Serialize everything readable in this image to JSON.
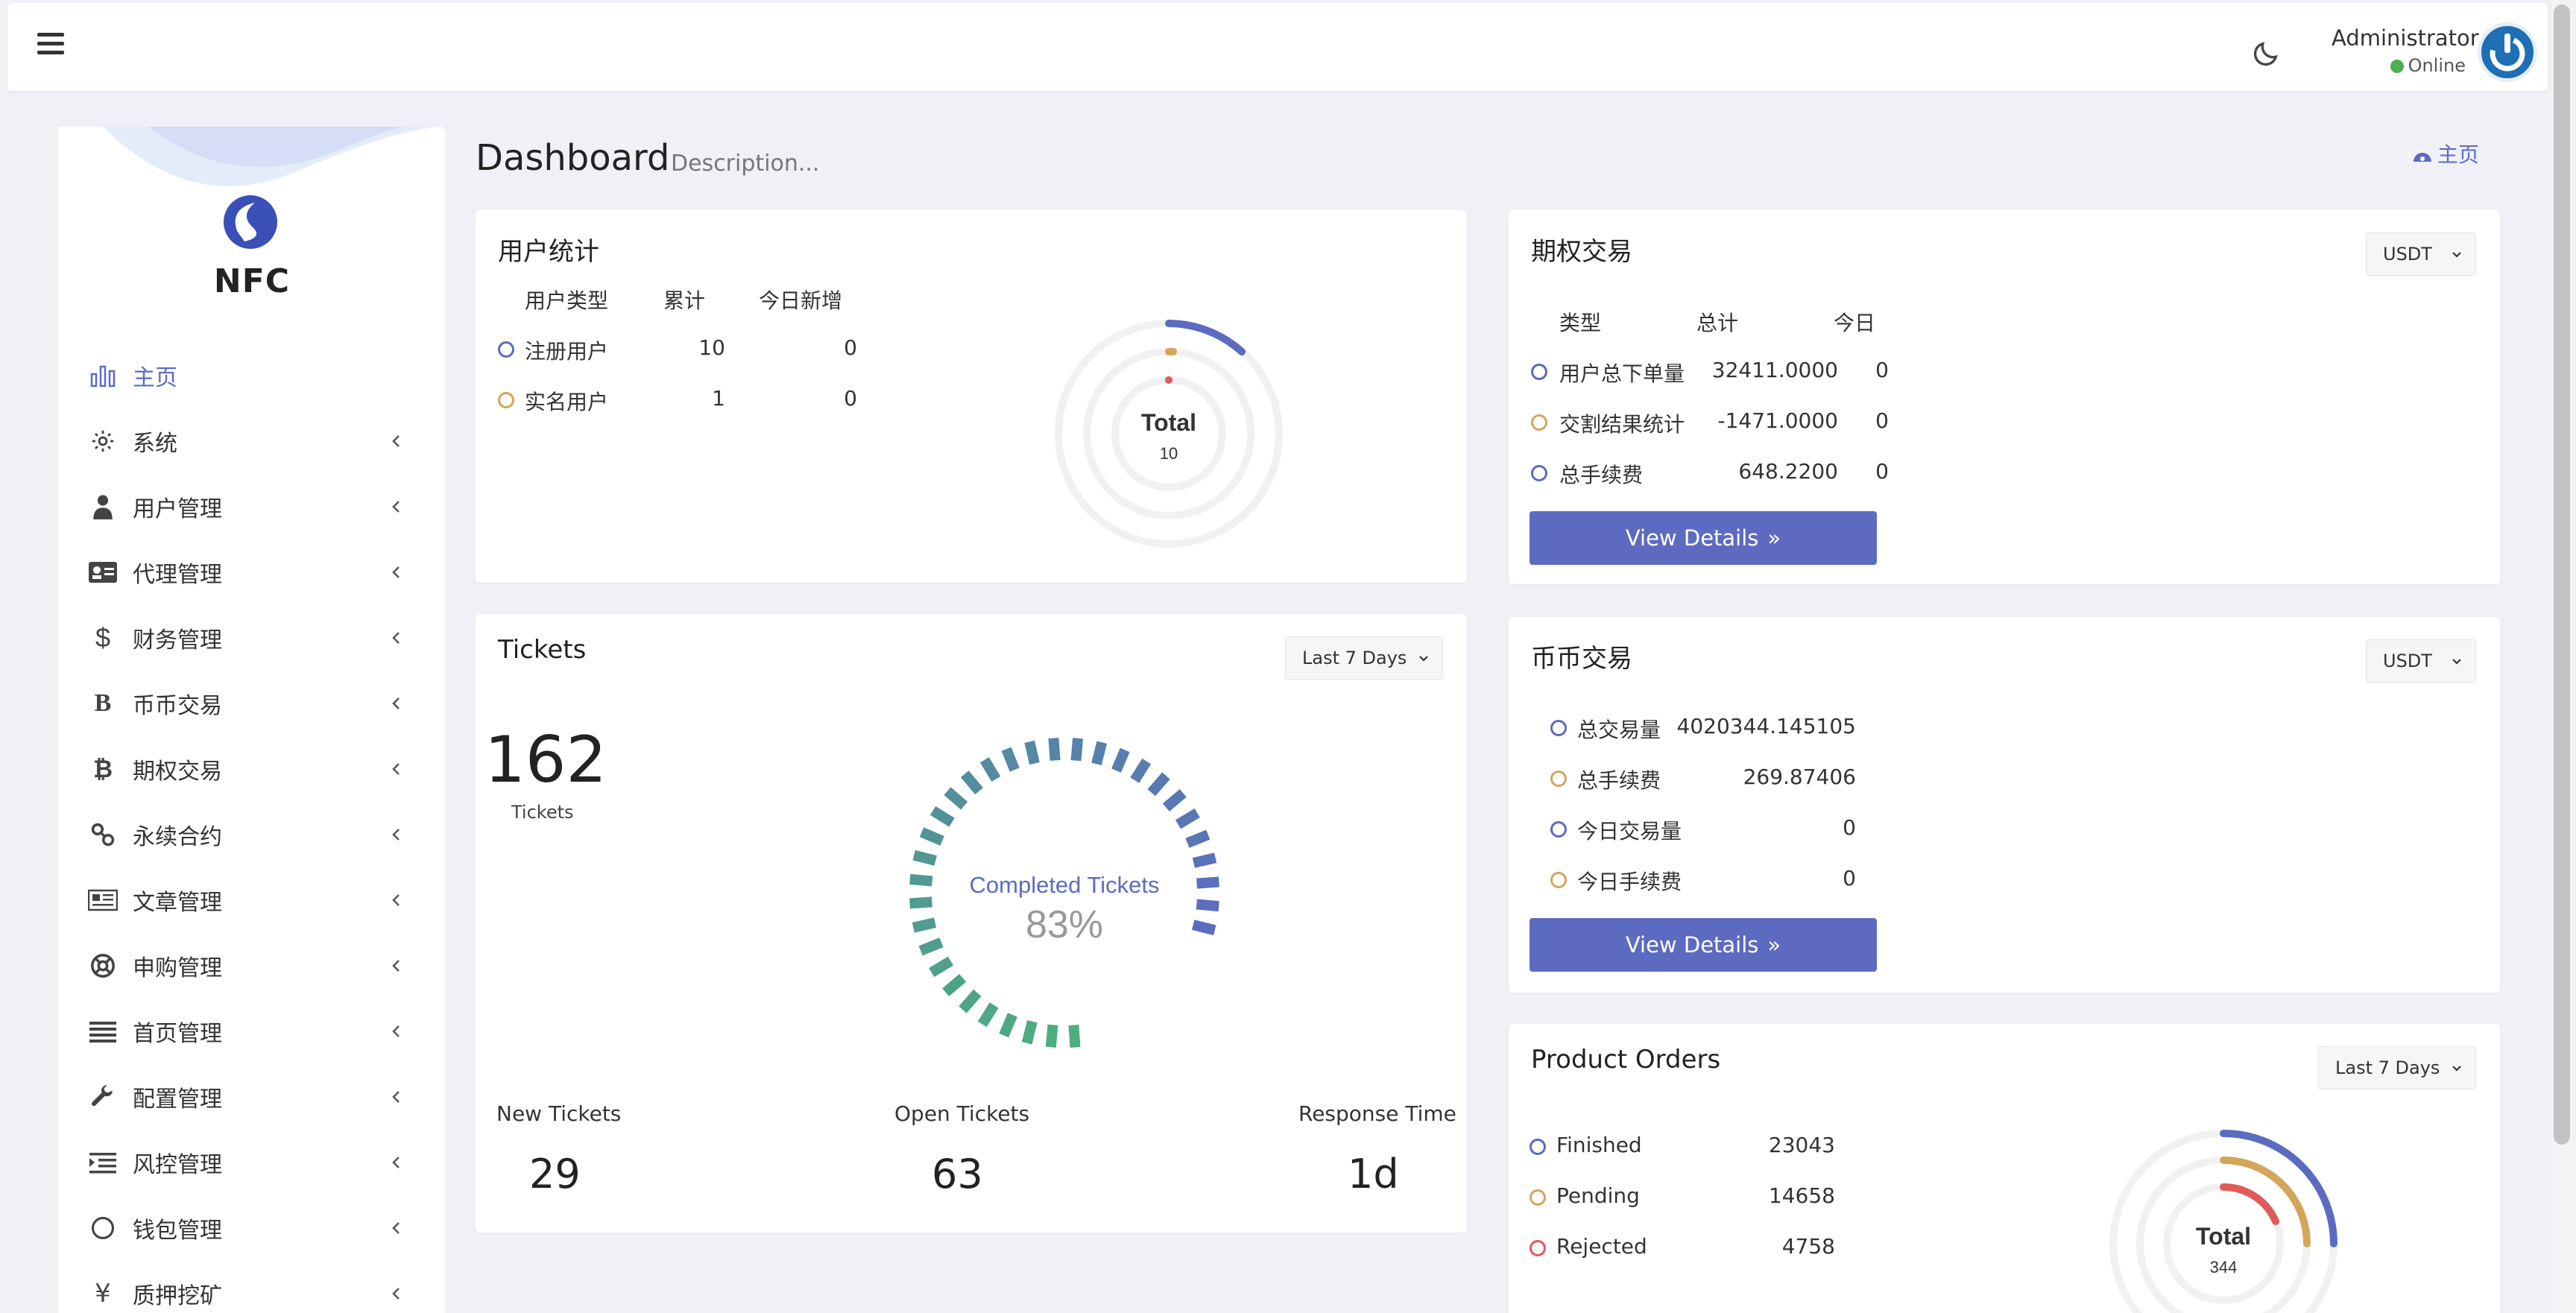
{
  "topbar": {
    "user_name": "Administrator",
    "user_status": "Online"
  },
  "sidebar": {
    "brand": "NFC",
    "items": [
      {
        "label": "主页",
        "icon": "bar-chart-icon"
      },
      {
        "label": "系统",
        "icon": "gear-icon"
      },
      {
        "label": "用户管理",
        "icon": "user-icon"
      },
      {
        "label": "代理管理",
        "icon": "id-card-icon"
      },
      {
        "label": "财务管理",
        "icon": "dollar-icon"
      },
      {
        "label": "币币交易",
        "icon": "bold-b-icon"
      },
      {
        "label": "期权交易",
        "icon": "bitcoin-icon"
      },
      {
        "label": "永续合约",
        "icon": "link-icon"
      },
      {
        "label": "文章管理",
        "icon": "newspaper-icon"
      },
      {
        "label": "申购管理",
        "icon": "life-ring-icon"
      },
      {
        "label": "首页管理",
        "icon": "list-icon"
      },
      {
        "label": "配置管理",
        "icon": "wrench-icon"
      },
      {
        "label": "风控管理",
        "icon": "indent-icon"
      },
      {
        "label": "钱包管理",
        "icon": "circle-icon"
      },
      {
        "label": "质押挖矿",
        "icon": "yen-icon"
      }
    ]
  },
  "header": {
    "title": "Dashboard",
    "subtitle": "Description...",
    "breadcrumb": "主页"
  },
  "user_stats": {
    "title": "用户统计",
    "headers": [
      "用户类型",
      "累计",
      "今日新增"
    ],
    "rows": [
      {
        "type": "注册用户",
        "total": "10",
        "today": "0",
        "color": "#5c6bc0"
      },
      {
        "type": "实名用户",
        "total": "1",
        "today": "0",
        "color": "#d4a55a"
      }
    ],
    "donut_label": "Total",
    "donut_value": "10"
  },
  "options": {
    "title": "期权交易",
    "currency": "USDT",
    "headers": [
      "类型",
      "总计",
      "今日"
    ],
    "rows": [
      {
        "type": "用户总下单量",
        "total": "32411.0000",
        "today": "0",
        "color": "#5c6bc0"
      },
      {
        "type": "交割结果统计",
        "total": "-1471.0000",
        "today": "0",
        "color": "#d4a55a"
      },
      {
        "type": "总手续费",
        "total": "648.2200",
        "today": "0",
        "color": "#5c6bc0"
      }
    ],
    "button": "View Details"
  },
  "tickets": {
    "title": "Tickets",
    "range": "Last 7 Days",
    "total": "162",
    "total_label": "Tickets",
    "gauge_label": "Completed Tickets",
    "gauge_value": "83%",
    "completed_fraction": 0.83,
    "stats": [
      {
        "label": "New Tickets",
        "value": "29"
      },
      {
        "label": "Open Tickets",
        "value": "63"
      },
      {
        "label": "Response Time",
        "value": "1d"
      }
    ],
    "colors": {
      "start": "#4caf7d",
      "end": "#5c6bc0"
    }
  },
  "spot": {
    "title": "币币交易",
    "currency": "USDT",
    "rows": [
      {
        "label": "总交易量",
        "value": "4020344.145105",
        "color": "#5c6bc0"
      },
      {
        "label": "总手续费",
        "value": "269.87406",
        "color": "#d4a55a"
      },
      {
        "label": "今日交易量",
        "value": "0",
        "color": "#5c6bc0"
      },
      {
        "label": "今日手续费",
        "value": "0",
        "color": "#d4a55a"
      }
    ],
    "button": "View Details"
  },
  "orders": {
    "title": "Product Orders",
    "range": "Last 7 Days",
    "rows": [
      {
        "label": "Finished",
        "value": "23043",
        "color": "#5c6bc0"
      },
      {
        "label": "Pending",
        "value": "14658",
        "color": "#d4a55a"
      },
      {
        "label": "Rejected",
        "value": "4758",
        "color": "#e05a5a"
      }
    ],
    "donut_label": "Total",
    "donut_value": "344"
  }
}
